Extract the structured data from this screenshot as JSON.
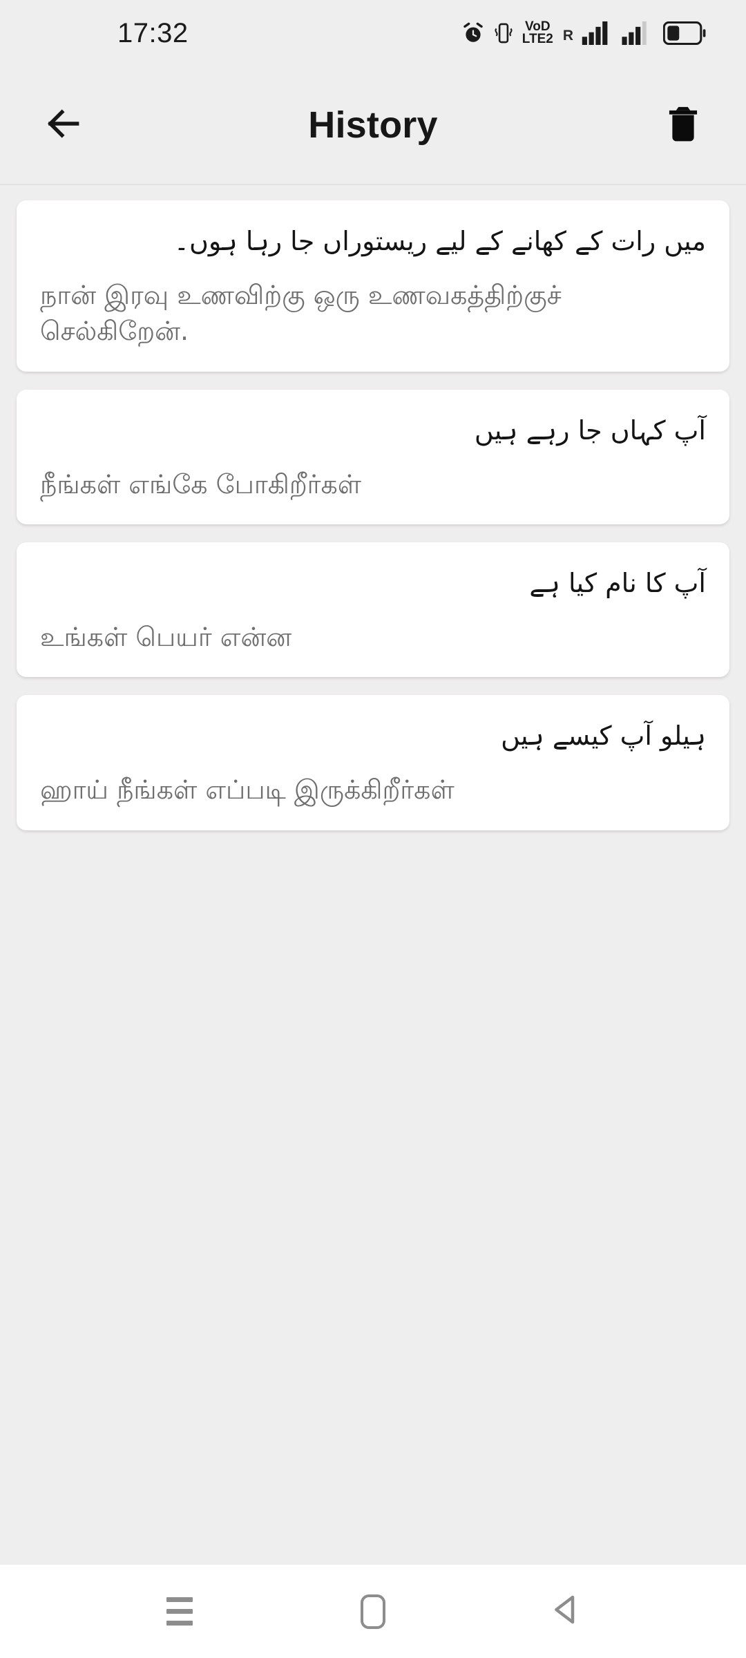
{
  "status_bar": {
    "time": "17:32",
    "icons": [
      {
        "name": "alarm-icon",
        "label": "alarm"
      },
      {
        "name": "vibrate-icon",
        "label": "vibrate"
      },
      {
        "name": "volte-icon",
        "label_top": "VoD",
        "label_bottom": "LTE2"
      },
      {
        "name": "roaming-icon",
        "label": "R"
      },
      {
        "name": "signal-sim1-icon",
        "label": "signal"
      },
      {
        "name": "signal-sim2-icon",
        "label": "signal"
      },
      {
        "name": "battery-icon",
        "label": "battery"
      }
    ]
  },
  "app_bar": {
    "title": "History",
    "back_label": "Back",
    "delete_label": "Delete all history"
  },
  "history": {
    "items": [
      {
        "source": "میں رات کے کھانے کے لیے ریستوراں جا رہا ہوں۔",
        "target": "நான் இரவு உணவிற்கு ஒரு உணவகத்திற்குச் செல்கிறேன்."
      },
      {
        "source": "آپ کہاں جا رہے ہیں",
        "target": "நீங்கள் எங்கே போகிறீர்கள்"
      },
      {
        "source": "آپ کا نام کیا ہے",
        "target": "உங்கள் பெயர் என்ன"
      },
      {
        "source": "ہیلو آپ کیسے ہیں",
        "target": "ஹாய் நீங்கள் எப்படி இருக்கிறீர்கள்"
      }
    ]
  },
  "nav_bar": {
    "recents_label": "Recent apps",
    "home_label": "Home",
    "back_label": "Back"
  },
  "colors": {
    "background": "#efeeee",
    "card": "#ffffff",
    "source_text": "#141414",
    "target_text": "#6e6e6e",
    "nav_icon": "#8d8d8d",
    "appbar_text": "#171717"
  }
}
